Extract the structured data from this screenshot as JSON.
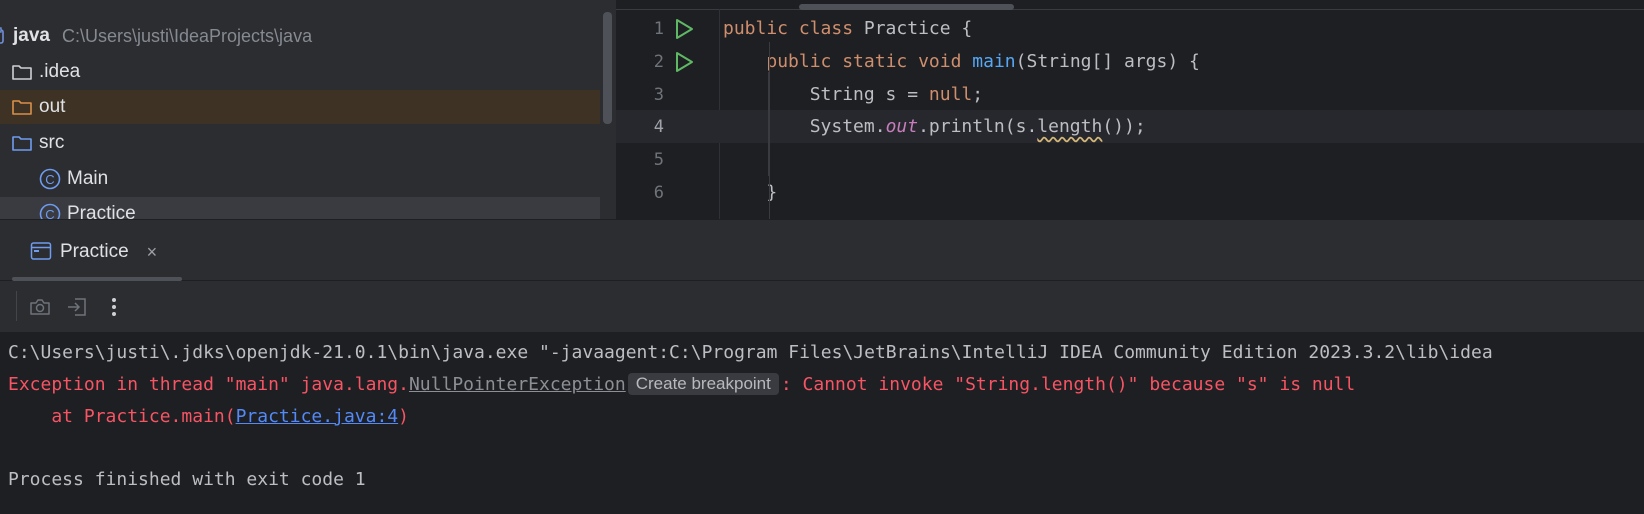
{
  "project": {
    "root": {
      "name": "java",
      "path": "C:\\Users\\justi\\IdeaProjects\\java"
    },
    "items": [
      {
        "label": ".idea",
        "icon": "folder-icon"
      },
      {
        "label": "out",
        "icon": "folder-icon-orange"
      },
      {
        "label": "src",
        "icon": "folder-icon-blue"
      },
      {
        "label": "Main",
        "icon": "class-icon"
      },
      {
        "label": "Practice",
        "icon": "class-icon"
      }
    ]
  },
  "editor": {
    "current_line": 4,
    "lines": [
      {
        "num": "1",
        "text": "public class Practice {"
      },
      {
        "num": "2",
        "text": "    public static void main(String[] args) {"
      },
      {
        "num": "3",
        "text": "        String s = null;"
      },
      {
        "num": "4",
        "text": "        System.out.println(s.length());"
      },
      {
        "num": "5",
        "text": ""
      },
      {
        "num": "6",
        "text": "    }"
      }
    ],
    "tokens": {
      "l1_kw": "public class",
      "l1_rest": " Practice {",
      "l2_kw": "public static void",
      "l2_fn": "main",
      "l2_rest": "(String[] args) {",
      "l3_a": "String s = ",
      "l3_kw": "null",
      "l3_b": ";",
      "l4_a": "System.",
      "l4_field": "out",
      "l4_b": ".println(s.",
      "l4_warn": "length",
      "l4_c": "());",
      "l6": "}"
    }
  },
  "run": {
    "tab_label": "Practice",
    "close_glyph": "×",
    "toolbar": [
      "camera-icon",
      "exit-icon",
      "more-vertical-icon"
    ]
  },
  "console": {
    "cmd": "C:\\Users\\justi\\.jdks\\openjdk-21.0.1\\bin\\java.exe \"-javaagent:C:\\Program Files\\JetBrains\\IntelliJ IDEA Community Edition 2023.3.2\\lib\\idea",
    "err_prefix": "Exception in thread \"main\" java.lang.",
    "err_link": "NullPointerException",
    "breakpoint_chip": "Create breakpoint",
    "err_suffix": ": Cannot invoke \"String.length()\" because \"s\" is null",
    "trace_prefix": "    at Practice.main(",
    "trace_link": "Practice.java:4",
    "trace_suffix": ")",
    "exit": "Process finished with exit code 1"
  },
  "colors": {
    "background": "#1e1f22",
    "panel": "#2b2d30",
    "keyword": "#cf8e6d",
    "function": "#56a8f5",
    "static_field": "#c77dbb",
    "error": "#f75464",
    "link": "#548af7",
    "run_icon": "#5fb865"
  }
}
